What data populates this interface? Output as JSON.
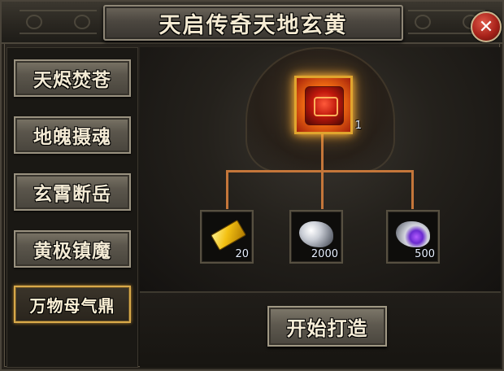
{
  "window": {
    "title": "天启传奇天地玄黄"
  },
  "close_button": {
    "label": "✕"
  },
  "sidebar": {
    "items": [
      {
        "label": "天烬焚苍",
        "active": false
      },
      {
        "label": "地魄摄魂",
        "active": false
      },
      {
        "label": "玄霄断岳",
        "active": false
      },
      {
        "label": "黄极镇魔",
        "active": false
      },
      {
        "label": "万物母气鼎",
        "active": true
      }
    ]
  },
  "recipe": {
    "product": {
      "icon": "red-demon-mask-icon",
      "count": "1"
    },
    "materials": [
      {
        "icon": "gold-bar-icon",
        "count": "20"
      },
      {
        "icon": "silver-ore-icon",
        "count": "2000"
      },
      {
        "icon": "purple-crystal-ore-icon",
        "count": "500"
      }
    ],
    "connector_color": "#c4763a"
  },
  "forge_button": {
    "label": "开始打造"
  },
  "colors": {
    "highlight_gold": "#e0a52e",
    "button_text": "#f3ead4"
  }
}
